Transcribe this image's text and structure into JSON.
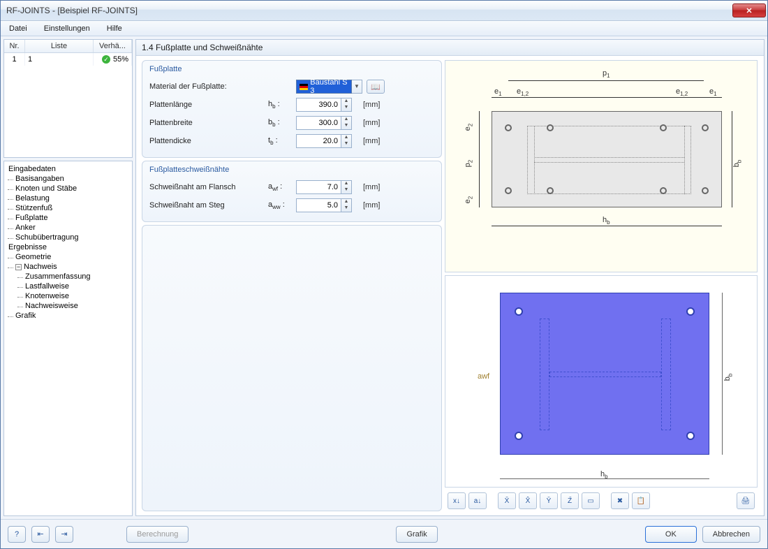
{
  "window": {
    "title": "RF-JOINTS - [Beispiel RF-JOINTS]"
  },
  "menu": {
    "file": "Datei",
    "settings": "Einstellungen",
    "help": "Hilfe"
  },
  "grid": {
    "headers": {
      "nr": "Nr.",
      "list": "Liste",
      "ratio": "Verhä..."
    },
    "row": {
      "nr": "1",
      "list": "1",
      "ratio": "55%"
    }
  },
  "tree": {
    "eingabe": "Eingabedaten",
    "basis": "Basisangaben",
    "knoten": "Knoten und Stäbe",
    "belastung": "Belastung",
    "stuetz": "Stützenfuß",
    "fussplatte": "Fußplatte",
    "anker": "Anker",
    "schub": "Schubübertragung",
    "ergebnisse": "Ergebnisse",
    "geometrie": "Geometrie",
    "nachweis": "Nachweis",
    "zusammen": "Zusammenfassung",
    "lastfall": "Lastfallweise",
    "knotenw": "Knotenweise",
    "nachweisw": "Nachweisweise",
    "grafik": "Grafik"
  },
  "panel": {
    "title": "1.4 Fußplatte und Schweißnähte"
  },
  "group1": {
    "title": "Fußplatte",
    "material_lbl": "Material der Fußplatte:",
    "material_val": "Baustahl S 3",
    "len_lbl": "Plattenlänge",
    "len_sym": "h",
    "len_sub": "b",
    "len_colon": " :",
    "len_val": "390.0",
    "wid_lbl": "Plattenbreite",
    "wid_sym": "b",
    "wid_sub": "b",
    "wid_val": "300.0",
    "thk_lbl": "Plattendicke",
    "thk_sym": "t",
    "thk_sub": "b",
    "thk_val": "20.0",
    "unit": "[mm]"
  },
  "group2": {
    "title": "Fußplatteschweißnähte",
    "fl_lbl": "Schweißnaht am Flansch",
    "fl_sym": "a",
    "fl_sub": "wf",
    "fl_val": "7.0",
    "st_lbl": "Schweißnaht am Steg",
    "st_sym": "a",
    "st_sub": "ww",
    "st_val": "5.0",
    "unit": "[mm]"
  },
  "dims": {
    "p1": "p",
    "p1s": "1",
    "e1": "e",
    "e1s": "1",
    "e12": "e",
    "e12s": "1,2",
    "e2": "e",
    "e2s": "2",
    "p2": "p",
    "p2s": "2",
    "hb": "h",
    "hbs": "b",
    "bb": "b",
    "bbs": "b",
    "awf": "awf"
  },
  "footer": {
    "berechnung": "Berechnung",
    "grafik": "Grafik",
    "ok": "OK",
    "abbrechen": "Abbrechen"
  }
}
